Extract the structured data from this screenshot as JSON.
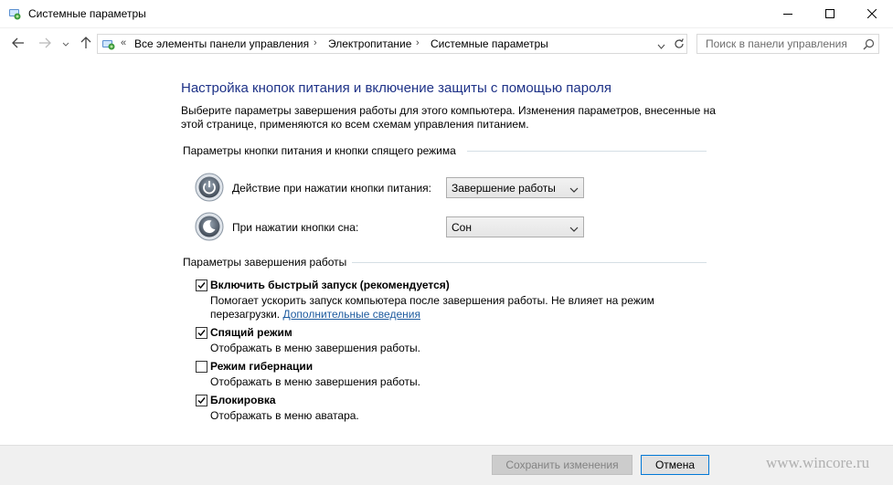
{
  "window": {
    "title": "Системные параметры",
    "icons": {
      "app": "control-panel-icon",
      "minimize": "minimize-icon",
      "maximize": "maximize-icon",
      "close": "close-icon"
    }
  },
  "nav": {
    "back_icon": "arrow-left-icon",
    "forward_icon": "arrow-right-icon",
    "recent_icon": "chevron-down-icon",
    "up_icon": "arrow-up-icon",
    "overflow": "«",
    "breadcrumbs": [
      "Все элементы панели управления",
      "Электропитание",
      "Системные параметры"
    ],
    "refresh_icon": "refresh-icon",
    "search_placeholder": "Поиск в панели управления"
  },
  "main": {
    "title": "Настройка кнопок питания и включение защиты с помощью пароля",
    "intro": "Выберите параметры завершения работы для этого компьютера. Изменения параметров, внесенные на этой странице, применяются ко всем схемам управления питанием.",
    "buttons_group": {
      "heading": "Параметры кнопки питания и кнопки спящего режима",
      "power": {
        "label": "Действие при нажатии кнопки питания:",
        "value": "Завершение работы",
        "icon": "power-button-icon"
      },
      "sleep": {
        "label": "При нажатии кнопки сна:",
        "value": "Сон",
        "icon": "sleep-button-icon"
      }
    },
    "shutdown_group": {
      "heading": "Параметры завершения работы",
      "options": [
        {
          "label": "Включить быстрый запуск (рекомендуется)",
          "checked": true,
          "desc1": "Помогает ускорить запуск компьютера после завершения работы. Не влияет на режим",
          "desc2": "перезагрузки.",
          "link": "Дополнительные сведения"
        },
        {
          "label": "Спящий режим",
          "checked": true,
          "desc1": "Отображать в меню завершения работы."
        },
        {
          "label": "Режим гибернации",
          "checked": false,
          "desc1": "Отображать в меню завершения работы."
        },
        {
          "label": "Блокировка",
          "checked": true,
          "desc1": "Отображать в меню аватара."
        }
      ]
    }
  },
  "footer": {
    "save_label": "Сохранить изменения",
    "cancel_label": "Отмена",
    "watermark": "www.wincore.ru"
  },
  "colors": {
    "title": "#1e3287",
    "link": "#1c5a9e",
    "accent": "#0078d7"
  }
}
